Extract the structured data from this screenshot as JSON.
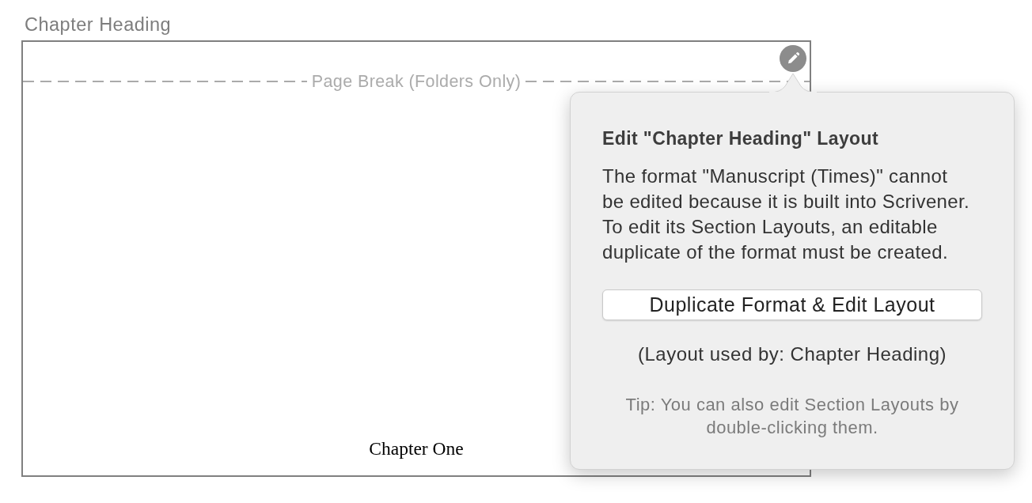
{
  "section": {
    "title": "Chapter Heading",
    "page_break_label": "Page Break (Folders Only)",
    "preview_text": "Chapter One"
  },
  "popover": {
    "title": "Edit \"Chapter Heading\" Layout",
    "message": "The format \"Manuscript (Times)\" cannot be edited because it is built into Scrivener. To edit its Section Layouts, an editable duplicate of the format must be created.",
    "button": "Duplicate Format & Edit Layout",
    "used_by": "(Layout used by: Chapter Heading)",
    "tip": "Tip: You can also edit Section Layouts by double-clicking them."
  }
}
